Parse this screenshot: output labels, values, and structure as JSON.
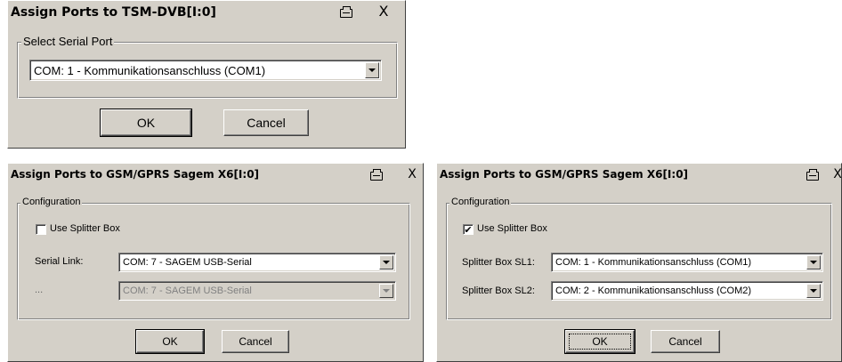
{
  "dialog1": {
    "title": "Assign Ports to TSM-DVB[I:0]",
    "close_label": "X",
    "group_label": "Select Serial Port",
    "serial_port_value": "COM: 1 - Kommunikationsanschluss (COM1)",
    "ok_label": "OK",
    "cancel_label": "Cancel"
  },
  "dialog2": {
    "title": "Assign Ports to GSM/GPRS Sagem X6[I:0]",
    "close_label": "X",
    "group_label": "Configuration",
    "use_splitter_label": "Use Splitter Box",
    "use_splitter_checked": false,
    "serial_link_label": "Serial Link:",
    "serial_link_value": "COM: 7 - SAGEM USB-Serial",
    "second_label": "...",
    "second_value": "COM: 7 - SAGEM USB-Serial",
    "ok_label": "OK",
    "cancel_label": "Cancel"
  },
  "dialog3": {
    "title": "Assign Ports to GSM/GPRS Sagem X6[I:0]",
    "close_label": "X",
    "group_label": "Configuration",
    "use_splitter_label": "Use Splitter Box",
    "use_splitter_checked": true,
    "check_glyph": "✔",
    "sl1_label": "Splitter Box SL1:",
    "sl1_value": "COM: 1 - Kommunikationsanschluss (COM1)",
    "sl2_label": "Splitter Box SL2:",
    "sl2_value": "COM: 2 - Kommunikationsanschluss (COM2)",
    "ok_label": "OK",
    "cancel_label": "Cancel"
  },
  "icons": {
    "printer": "printer-icon",
    "close": "close-icon",
    "dropdown": "chevron-down-icon"
  },
  "colors": {
    "dialog_bg": "#d4d0c8",
    "field_bg": "#ffffff",
    "disabled_text": "#808080"
  }
}
